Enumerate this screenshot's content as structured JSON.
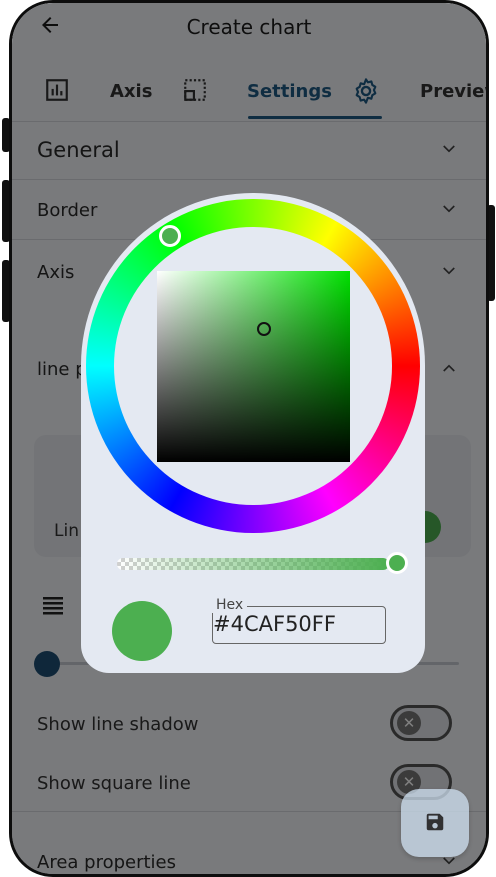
{
  "appbar": {
    "title": "Create chart"
  },
  "tabs": [
    {
      "label": "Axis",
      "icon": "bar-chart-icon"
    },
    {
      "label": "Settings",
      "icon": "settings-grid-icon",
      "active": true
    },
    {
      "label": "Preview",
      "icon": "gear-icon"
    }
  ],
  "sections": {
    "general": "General",
    "border": "Border",
    "axis": "Axis",
    "line_properties": "line p",
    "card_label": "Lin",
    "area_properties": "Area properties"
  },
  "toggles": {
    "shadow_label": "Show line shadow",
    "square_label": "Show square line"
  },
  "color_picker": {
    "hex_label": "Hex",
    "hex_value": "#4CAF50FF",
    "color": "#4CAF50",
    "alpha": 1.0
  },
  "colors": {
    "accent": "#1F5B85",
    "selected_color": "#4CAF50"
  }
}
